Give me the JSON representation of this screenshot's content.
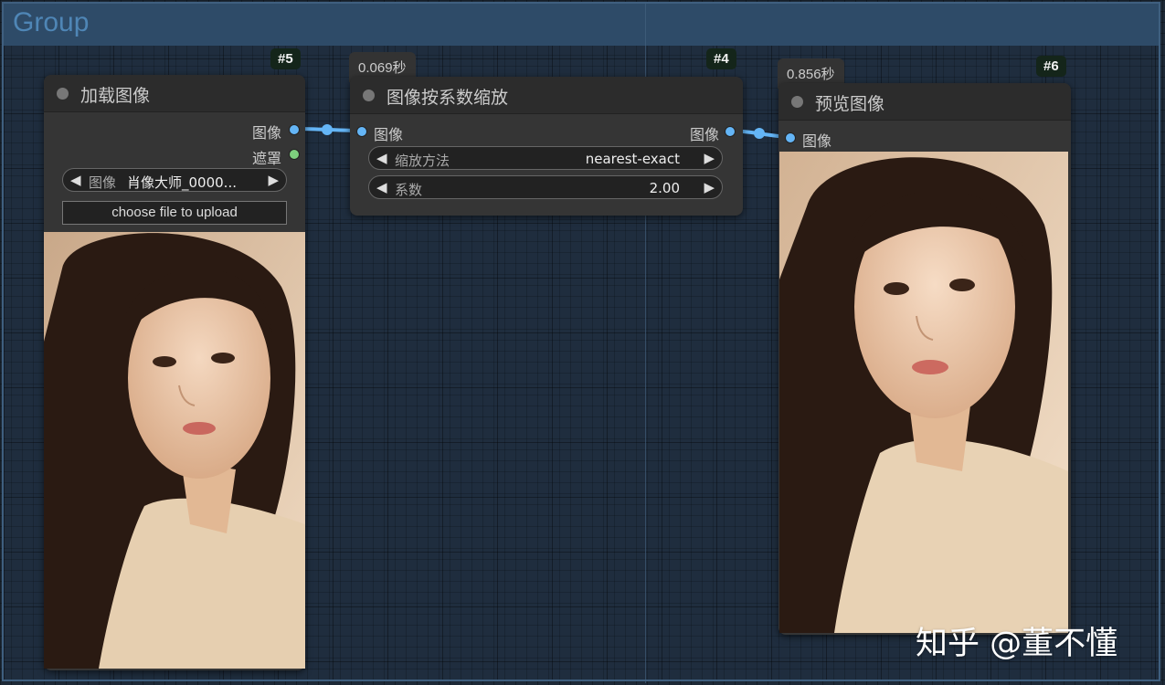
{
  "group": {
    "title": "Group"
  },
  "nodes": {
    "load": {
      "id": "#5",
      "title": "加载图像",
      "outputs": [
        "图像",
        "遮罩"
      ],
      "image_widget": {
        "label": "图像",
        "value": "肖像大师_0000..."
      },
      "upload_label": "choose file to upload"
    },
    "scale": {
      "id": "#4",
      "timer": "0.069秒",
      "title": "图像按系数缩放",
      "input": "图像",
      "output": "图像",
      "method_widget": {
        "label": "缩放方法",
        "value": "nearest-exact"
      },
      "factor_widget": {
        "label": "系数",
        "value": "2.00"
      }
    },
    "preview": {
      "id": "#6",
      "timer": "0.856秒",
      "title": "预览图像",
      "input": "图像"
    }
  },
  "watermark": "知乎 @董不懂",
  "colors": {
    "image_port": "#64b5f6",
    "mask_port": "#7dcf7d",
    "link": "#64b5f6",
    "badge_bg": "#14251a"
  },
  "icons": {
    "left_arrow": "◀",
    "right_arrow": "▶"
  }
}
